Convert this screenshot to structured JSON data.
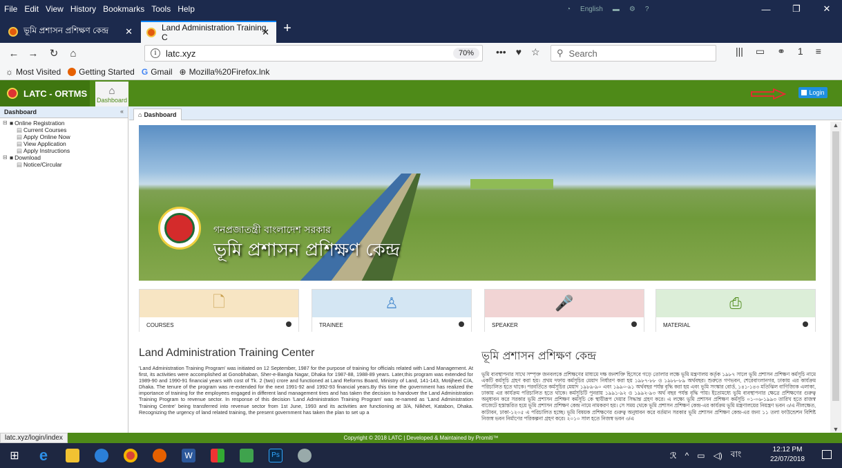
{
  "browser": {
    "menu": [
      "File",
      "Edit",
      "View",
      "History",
      "Bookmarks",
      "Tools",
      "Help"
    ],
    "tray_lang": "English",
    "tabs": [
      {
        "title": "ভূমি প্রশাসন প্রশিক্ষণ কেন্দ্র",
        "active": false
      },
      {
        "title": "Land Administration Training C",
        "active": true
      }
    ],
    "url": "latc.xyz",
    "zoom": "70%",
    "search_placeholder": "Search",
    "notification_count": "1",
    "bookmarks": [
      "Most Visited",
      "Getting Started",
      "Gmail",
      "Mozilla%20Firefox.lnk"
    ],
    "status_url": "latc.xyz/login/index"
  },
  "app": {
    "brand": "LATC - ORTMS",
    "home_label": "Dashboard",
    "login_label": "Login",
    "accent": "#4e8a18",
    "sidebar": {
      "title": "Dashboard",
      "tree": [
        {
          "label": "Online Registration",
          "level": 1
        },
        {
          "label": "Current Courses",
          "level": 2
        },
        {
          "label": "Apply Online Now",
          "level": 2
        },
        {
          "label": "View Application",
          "level": 2
        },
        {
          "label": "Apply Instructions",
          "level": 2
        },
        {
          "label": "Download",
          "level": 1
        },
        {
          "label": "Notice/Circular",
          "level": 2
        }
      ]
    },
    "content_tab": "Dashboard",
    "banner": {
      "subtitle": "গনপ্রজাতন্ত্রী বাংলাদেশ সরকার",
      "title": "ভূমি প্রশাসন প্রশিক্ষণ কেন্দ্র"
    },
    "tiles": [
      {
        "label": "COURSES",
        "icon": "file-icon"
      },
      {
        "label": "TRAINEE",
        "icon": "user-icon"
      },
      {
        "label": "SPEAKER",
        "icon": "microphone-icon"
      },
      {
        "label": "MATERIAL",
        "icon": "pdf-icon"
      }
    ],
    "about_en": {
      "heading": "Land Administration Training Center",
      "body": "'Land Administration Training Program' was initiated on 12 September, 1987 for the purpose of training for officials related with Land Management. At first, its activities were accomplished at Gonobhaban, Sher-e-Bangla Nagar, Dhaka for 1987-88, 1988-89 years. Later,this program was extended for 1989-90 and 1990-91 financial years with cost of Tk. 2 (two) crore and functioned at Land Reforms Board, Ministry of Land, 141-143, Motijheel C/A, Dhaka. The tenure of the program was re-extended for the next 1991-92 and 1992-93 financial years.By this time the government has realized the importance of training for the employees engaged in different land management tires and has taken the decision to handover the Land Administration Training Program to revenue sector. In response of this decision 'Land Administration Training Program' was re-named as 'Land Administration Training Centre' being transferred into revenue sector from 1st June, 1993 and its activities are functioning at 3/A, Nilkhet, Katabon, Dhaka. Recognizing the urgency of land related training, the present government has taken the plan to set up a"
    },
    "about_bn": {
      "heading": "ভূমি প্রশাসন প্রশিক্ষণ কেন্দ্র",
      "body": "ভূমি ব্যবস্থাপনার সাথে সম্পৃক্ত জনবলকে প্রশিক্ষণের মাধ্যমে দক্ষ জনশক্তি হিসেবে গড়ে তোলার লক্ষে ভূমি মন্ত্রণালয় কর্তৃক ১৯৮৭ সালে ভূমি প্রশাসন প্রশিক্ষণ কর্মসূচি নামে একটি কর্মসূচি গ্রহণ করা হয়। প্রথম দফায় কর্মসূচির মেয়াদ নির্ধারণ করা হয় ১৯৮৭-৮৮ ও ১৯৮৮-৮৯ অর্থবছর। শুরুতে গণভবন, শেরেবাংলানগর, ঢাকায় এর কার্যক্রম পরিচালিত হতে থাকে। পরবর্তিতে কর্মসূচির মেয়াদ ১৯৮৯-৯০ এবং ১৯৯০-৯১ অর্থবছর পর্যন্ত বৃদ্ধি করা হয় এবং ভূমি সংস্কার বোর্ড, ১৪১-১৪৩ মতিঝিল বাণিজ্যিক এলাকা, ঢাকায় এর কার্যক্রম পরিচালিত হতে থাকে। কর্মসূচিটি পুনরায় ১৯৯১-৯২ ও ১৯৯২-৯৩ অর্থ বছর পর্যন্ত বৃদ্ধি পায়। ইতোমধ্যে ভূমি ব্যবস্থাপনার ক্ষেত্রে প্রশিক্ষণের গুরুত্ব অনুধাবন করে সরকার ভূমি প্রশাসন প্রশিক্ষণ কর্মসূচি কে স্থায়ীরূপ দেয়ার সিদ্ধান্ত গ্রহণ করে। এ লক্ষ্যে ভূমি প্রশাসন প্রশিক্ষণ কর্মসূচি ০১-০৬-১৯৯৩ তারিখ হতে রাজস্ব বাজেটে হস্তান্তরিত হয়ে ভূমি প্রশাসন প্রশিক্ষণ কেন্দ্র নামে নামকরণ হয়। সে সময় থেকে ভূমি প্রশাসন প্রশিক্ষণ কেন্দ্র-এর কার্যক্রম ভূমি মন্ত্রণালয়ের নিয়ন্ত্রণ ভবন ৩/এ নীলক্ষেত, কাটাবন, ঢাকা-১২০৫ এ পরিচালিত হচ্ছে। ভূমি বিষয়ক প্রশিক্ষণের গুরুত্ব অনুধাবন করে বর্তমান সরকার ভূমি প্রশাসন প্রশিক্ষণ কেন্দ্র-এর জন্য ১১ তলা ফাউন্ডেশন বিশিষ্ট নিজস্ব ভবন নির্মাণের পরিকল্পনা গ্রহণ করে। ২০১০ সাল হতে নিজস্ব ভবন ৩/এ"
    },
    "footer": "Copyright © 2018 LATC | Developed & Maintained by Promiti™"
  },
  "taskbar": {
    "lang": "বাং",
    "time": "12:12 PM",
    "date": "22/07/2018"
  }
}
